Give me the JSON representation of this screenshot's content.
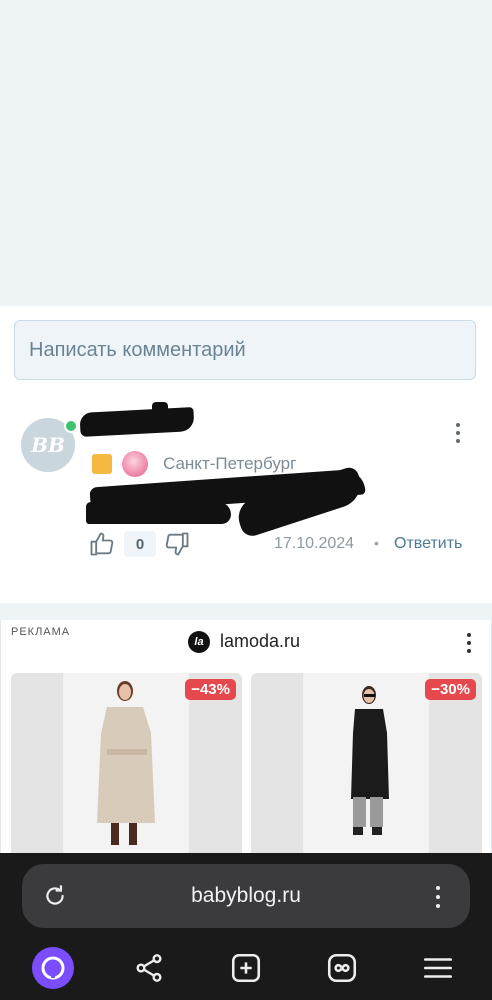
{
  "comment_input": {
    "placeholder": "Написать комментарий"
  },
  "comment": {
    "avatar_initials": "BB",
    "city": "Санкт-Петербург",
    "likes": "0",
    "date": "17.10.2024",
    "separator": "•",
    "reply_label": "Ответить"
  },
  "ad": {
    "label": "РЕКЛАМА",
    "logo_text": "la",
    "advertiser": "lamoda.ru",
    "products": [
      {
        "discount": "−43%",
        "color": "beige-coat"
      },
      {
        "discount": "−30%",
        "color": "black-coat"
      }
    ]
  },
  "browser": {
    "url": "babyblog.ru",
    "nav": [
      "alice",
      "share",
      "new-tab",
      "tabs",
      "menu"
    ]
  },
  "colors": {
    "accent_alice": "#7b4dff",
    "discount_bg": "#e5484d",
    "reply_link": "#4b7a94"
  }
}
